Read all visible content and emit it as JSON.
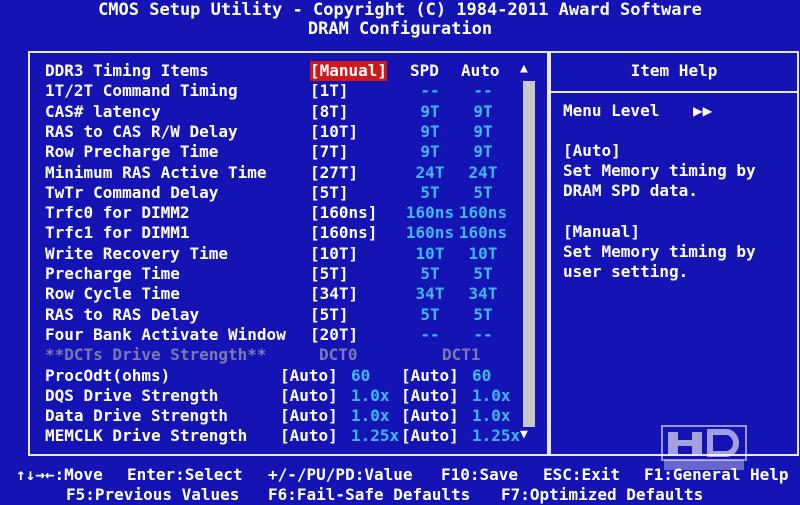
{
  "header": {
    "title": "CMOS Setup Utility - Copyright (C) 1984-2011 Award Software",
    "subtitle": "DRAM Configuration"
  },
  "columns": {
    "spd": "SPD",
    "auto": "Auto"
  },
  "rows": [
    {
      "label": "DDR3 Timing Items",
      "value": "[Manual]",
      "spd": "",
      "auto": ""
    },
    {
      "label": "1T/2T Command Timing",
      "value": "[1T]",
      "spd": "--",
      "auto": "--"
    },
    {
      "label": "CAS# latency",
      "value": "[8T]",
      "spd": "9T",
      "auto": "9T"
    },
    {
      "label": "RAS to CAS R/W Delay",
      "value": "[10T]",
      "spd": "9T",
      "auto": "9T"
    },
    {
      "label": "Row Precharge Time",
      "value": "[7T]",
      "spd": "9T",
      "auto": "9T"
    },
    {
      "label": "Minimum RAS Active Time",
      "value": "[27T]",
      "spd": "24T",
      "auto": "24T"
    },
    {
      "label": "TwTr Command Delay",
      "value": "[5T]",
      "spd": "5T",
      "auto": "5T"
    },
    {
      "label": "Trfc0 for DIMM2",
      "value": "[160ns]",
      "spd": "160ns",
      "auto": "160ns"
    },
    {
      "label": "Trfc1 for DIMM1",
      "value": "[160ns]",
      "spd": "160ns",
      "auto": "160ns"
    },
    {
      "label": "Write Recovery Time",
      "value": "[10T]",
      "spd": "10T",
      "auto": "10T"
    },
    {
      "label": "Precharge Time",
      "value": "[5T]",
      "spd": "5T",
      "auto": "5T"
    },
    {
      "label": "Row Cycle Time",
      "value": "[34T]",
      "spd": "34T",
      "auto": "34T"
    },
    {
      "label": "RAS to RAS Delay",
      "value": "[5T]",
      "spd": "5T",
      "auto": "5T"
    },
    {
      "label": "Four Bank Activate Window",
      "value": "[20T]",
      "spd": "--",
      "auto": "--"
    }
  ],
  "dct_header": {
    "label": "**DCTs Drive Strength**",
    "dct0": "DCT0",
    "dct1": "DCT1"
  },
  "dct_rows": [
    {
      "label": "ProcOdt(ohms)",
      "v0": "[Auto]",
      "d0": "60",
      "v1": "[Auto]",
      "d1": "60"
    },
    {
      "label": "DQS Drive Strength",
      "v0": "[Auto]",
      "d0": "1.0x",
      "v1": "[Auto]",
      "d1": "1.0x"
    },
    {
      "label": "Data Drive Strength",
      "v0": "[Auto]",
      "d0": "1.0x",
      "v1": "[Auto]",
      "d1": "1.0x"
    },
    {
      "label": "MEMCLK Drive Strength",
      "v0": "[Auto]",
      "d0": "1.25x",
      "v1": "[Auto]",
      "d1": "1.25x"
    }
  ],
  "help": {
    "title": "Item Help",
    "menu_level": "Menu Level",
    "menu_level_arrows": "▶▶",
    "auto_title": "[Auto]",
    "auto_text1": "Set Memory timing by",
    "auto_text2": "DRAM SPD data.",
    "manual_title": "[Manual]",
    "manual_text1": "Set Memory timing by",
    "manual_text2": "user setting."
  },
  "footer": {
    "move": "↑↓→←:Move",
    "select": "Enter:Select",
    "value": "+/-/PU/PD:Value",
    "save": "F10:Save",
    "exit": "ESC:Exit",
    "help": "F1:General Help",
    "prev": "F5:Previous Values",
    "failsafe": "F6:Fail-Safe Defaults",
    "optimized": "F7:Optimized Defaults"
  },
  "colors": {
    "background": "#1414b4",
    "highlight": "#d01818",
    "cyan": "#3eb8f0",
    "dim": "#7a7ab0"
  },
  "icons": {
    "scroll_up": "up-triangle",
    "scroll_down": "down-triangle",
    "logo": "hd-club-logo"
  }
}
